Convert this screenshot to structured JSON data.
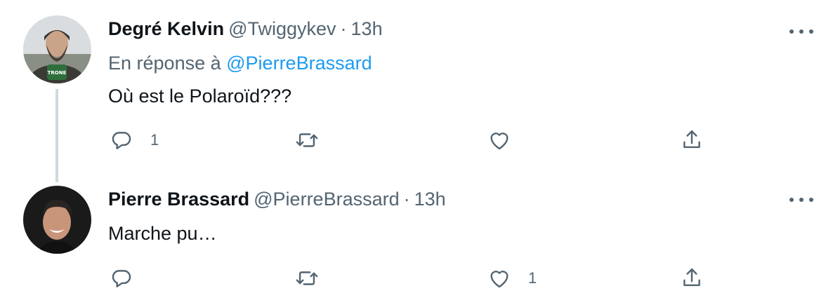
{
  "tweets": [
    {
      "name": "Degré Kelvin",
      "handle": "@Twiggykev",
      "separator": "·",
      "time": "13h",
      "reply_prefix": "En réponse à",
      "reply_mention": "@PierreBrassard",
      "text": "Où est le Polaroïd???",
      "reply_count": "1",
      "retweet_count": "",
      "like_count": "",
      "avatar_icon": "avatar-bearded-man-icon",
      "avatar_label": "TRONE"
    },
    {
      "name": "Pierre Brassard",
      "handle": "@PierreBrassard",
      "separator": "·",
      "time": "13h",
      "text": "Marche pu…",
      "reply_count": "",
      "retweet_count": "",
      "like_count": "1",
      "avatar_icon": "avatar-smiling-man-icon"
    }
  ],
  "colors": {
    "text_primary": "#0f1419",
    "text_secondary": "#536471",
    "mention": "#1d9bf0",
    "thread_line": "#cfd9de"
  },
  "icons": [
    "reply-icon",
    "retweet-icon",
    "like-icon",
    "share-icon",
    "more-options-icon"
  ]
}
